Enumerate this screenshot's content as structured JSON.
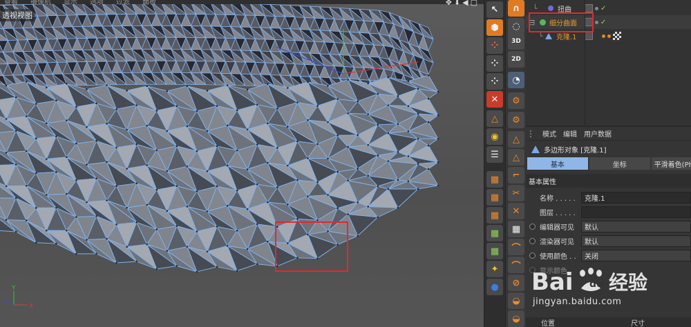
{
  "viewport": {
    "title": "透视视图",
    "menu": [
      "查看",
      "摄像机",
      "显示",
      "选项",
      "过滤",
      "面板"
    ],
    "axis": {
      "y": "Y",
      "z": "Z",
      "x": "X"
    },
    "nav_icons": "✥⬇◀▢"
  },
  "object_manager": {
    "rows": [
      {
        "name": "扭曲",
        "color": "#c9c9c9"
      },
      {
        "name": "细分曲面",
        "color": "#e49a29"
      },
      {
        "name": "克隆.1",
        "color": "#e49a29"
      }
    ],
    "highlight_color": "#e3282e"
  },
  "tools": {
    "left": [
      "↖",
      "⬢",
      "⁘",
      "⁘",
      "⁘",
      "✕",
      "△",
      "◉",
      "☰",
      "▦"
    ],
    "labels_3d": "3D",
    "labels_2d": "2D"
  },
  "attributes": {
    "menu": [
      "模式",
      "编辑",
      "用户数据"
    ],
    "object_line": "多边形对象 [克隆.1]",
    "tabs": [
      "基本",
      "坐标",
      "平滑着色(Ph"
    ],
    "section": "基本属性",
    "props": [
      {
        "label": "名称",
        "dots": " . . . . .",
        "value": "克隆.1",
        "radio": false
      },
      {
        "label": "图层",
        "dots": " . . . . .",
        "value": "",
        "radio": false
      },
      {
        "label": "编辑器可见",
        "dots": "",
        "value": "默认",
        "radio": true
      },
      {
        "label": "渲染器可见",
        "dots": "",
        "value": "默认",
        "radio": true
      },
      {
        "label": "使用颜色",
        "dots": " . .",
        "value": "关闭",
        "radio": true
      },
      {
        "label": "显示颜色",
        "dots": "",
        "value": "",
        "radio": true
      }
    ],
    "bottom_bar": {
      "left": "位置",
      "right": "尺寸"
    }
  },
  "watermark": {
    "brand": "Bai",
    "brand2": "du",
    "brand_cn": "经验",
    "url": "jingyan.baidu.com"
  },
  "colors": {
    "accent_red": "#e3282e",
    "mesh_edge": "#7fb2ec",
    "tab_active": "#8fb6e6"
  }
}
